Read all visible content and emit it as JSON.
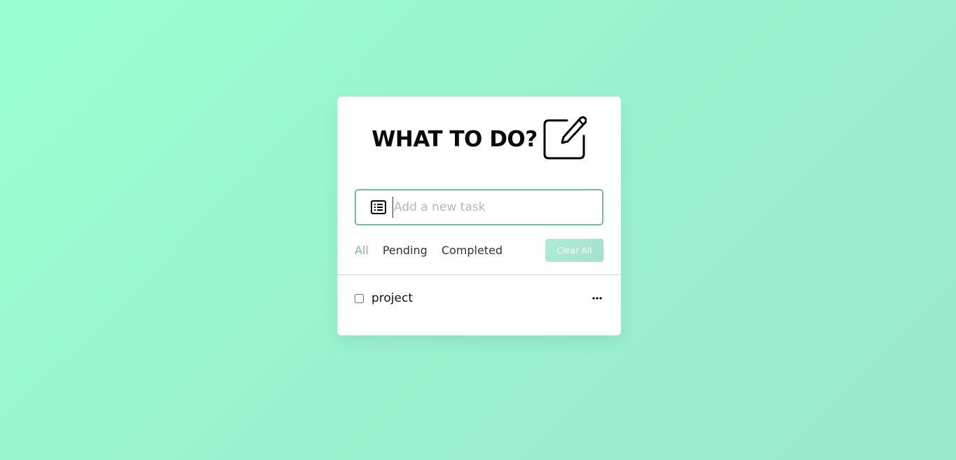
{
  "app": {
    "title": "WHAT TO DO?"
  },
  "icons": {
    "header": "edit-icon",
    "input": "list-icon",
    "task_menu": "more-horizontal-icon"
  },
  "colors": {
    "accent": "#74bca2",
    "background_start": "#9affd0",
    "background_end": "#99e9cb",
    "button": "#a8e3d1"
  },
  "input": {
    "placeholder": "Add a new task",
    "value": ""
  },
  "filters": {
    "items": [
      {
        "label": "All",
        "active": true
      },
      {
        "label": "Pending",
        "active": false
      },
      {
        "label": "Completed",
        "active": false
      }
    ],
    "clear_label": "Clear All"
  },
  "tasks": [
    {
      "label": "project",
      "completed": false
    }
  ]
}
